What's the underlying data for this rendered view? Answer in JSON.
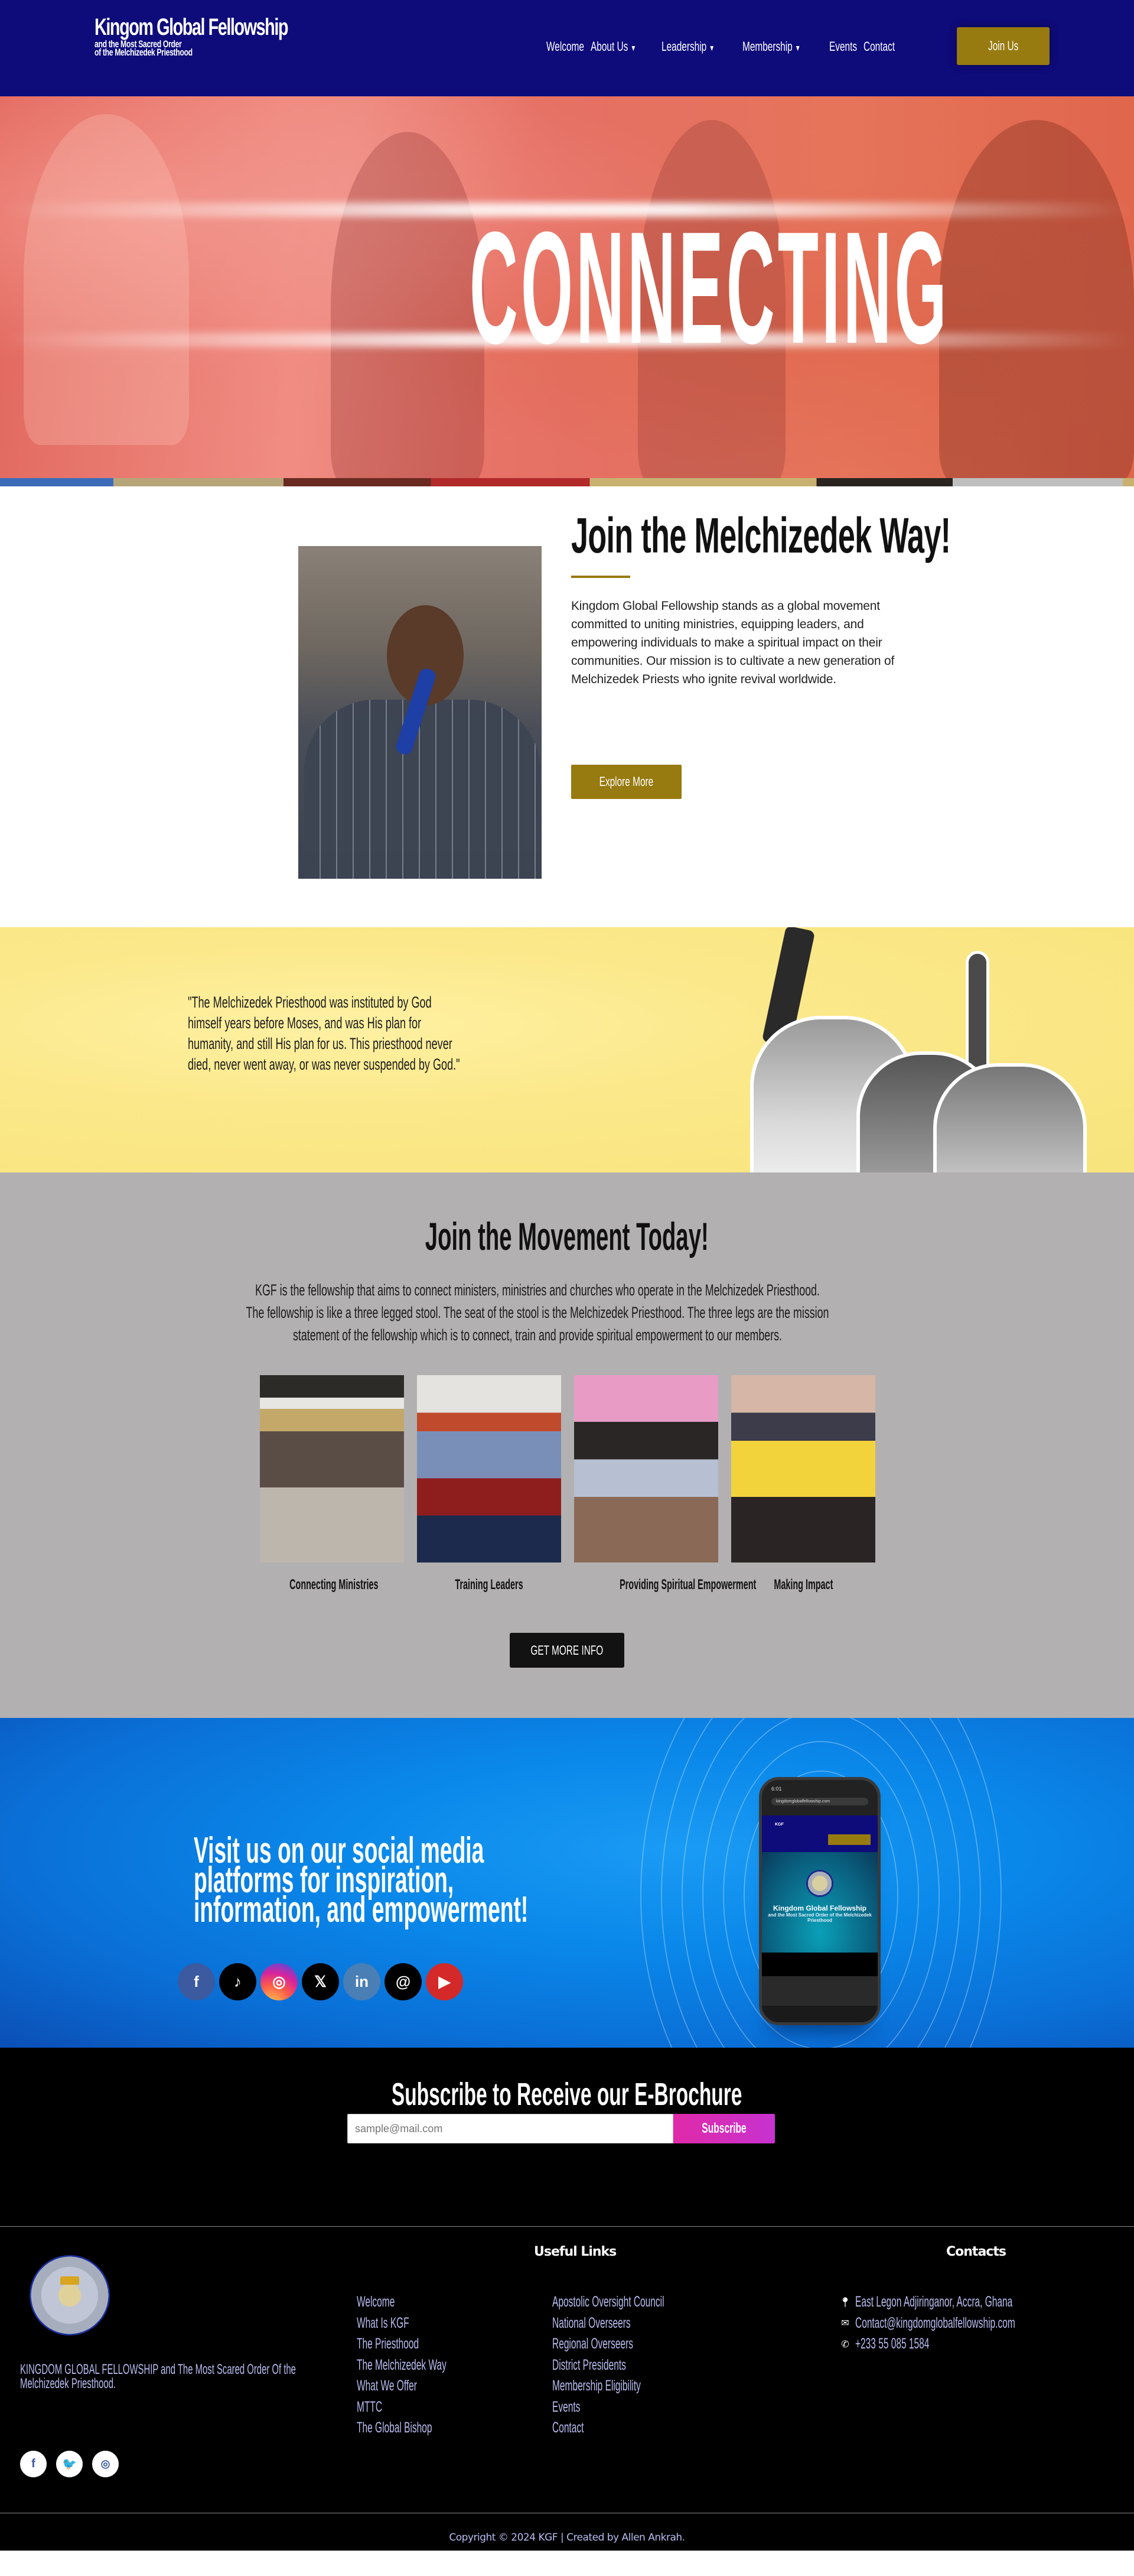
{
  "header": {
    "logo": {
      "title": "Kingom Global Fellowship",
      "subtitle_line1": "and the Most Sacred Order",
      "subtitle_line2": "of the Melchizedek Priesthood"
    },
    "nav": [
      {
        "label": "Welcome",
        "has_dropdown": false
      },
      {
        "label": "About Us",
        "has_dropdown": true
      },
      {
        "label": "Leadership",
        "has_dropdown": true
      },
      {
        "label": "Membership",
        "has_dropdown": true
      },
      {
        "label": "Events",
        "has_dropdown": false
      },
      {
        "label": "Contact",
        "has_dropdown": false
      }
    ],
    "join_label": "Join Us",
    "caret": "▼"
  },
  "hero": {
    "title": "CONNECTING"
  },
  "melchizedek": {
    "title": "Join the Melchizedek Way!",
    "body": "Kingdom Global Fellowship stands as a global movement committed to uniting ministries, equipping leaders, and empowering individuals to make a spiritual impact on their communities. Our mission is to cultivate a new generation of Melchizedek Priests who ignite revival worldwide.",
    "button_label": "Explore More"
  },
  "quote": {
    "text": "\"The Melchizedek Priesthood was instituted by God himself years before Moses, and was His plan for humanity, and still His plan for us. This priesthood never died, never went away, or was never suspended by God.\""
  },
  "movement": {
    "title": "Join the Movement Today!",
    "body": "KGF is the fellowship that aims to connect ministers, ministries and churches who operate in the Melchizedek Priesthood.  The fellowship is like a three legged stool.  The seat of the stool is the Melchizedek Priesthood.  The three legs are the mission statement of the fellowship which is to connect, train and provide spiritual empowerment to our members.",
    "cards": [
      {
        "caption": "Connecting Ministries"
      },
      {
        "caption": "Training Leaders"
      },
      {
        "caption": "Providing Spiritual Empowerment"
      },
      {
        "caption": "Making Impact"
      }
    ],
    "button_label": "GET MORE INFO"
  },
  "social": {
    "title": "Visit us on our social media platforms for inspiration, information, and empowerment!",
    "icons": [
      {
        "name": "facebook",
        "glyph": "f"
      },
      {
        "name": "tiktok",
        "glyph": "♪"
      },
      {
        "name": "instagram",
        "glyph": "◎"
      },
      {
        "name": "x",
        "glyph": "𝕏"
      },
      {
        "name": "linkedin",
        "glyph": "in"
      },
      {
        "name": "threads",
        "glyph": "@"
      },
      {
        "name": "youtube",
        "glyph": "▶"
      }
    ],
    "phone": {
      "time": "6:01",
      "url": "kingdomglobalfellowship.com",
      "screen_title": "Kingdom Global Fellowship",
      "screen_subtitle": "and the Most Sacred Order of the Melchizedek Priesthood"
    }
  },
  "subscribe": {
    "title": "Subscribe to Receive our E-Brochure",
    "email_placeholder": "sample@mail.com",
    "button_label": "Subscribe"
  },
  "footer": {
    "about": "KINGDOM GLOBAL FELLOWSHIP and The Most Scared Order Of the Melchizedek Priesthood.",
    "social": [
      {
        "name": "facebook",
        "glyph": "f"
      },
      {
        "name": "twitter",
        "glyph": "🐦"
      },
      {
        "name": "instagram",
        "glyph": "◎"
      }
    ],
    "useful_links_heading": "Useful Links",
    "links_col1": [
      "Welcome",
      "What Is KGF",
      "The Priesthood",
      "The Melchizedek Way",
      "What We Offer",
      "MTTC",
      "The Global Bishop"
    ],
    "links_col2": [
      "Apostolic Oversight Council",
      "National Overseers",
      "Regional Overseers",
      "District Presidents",
      "Membership Eligibility",
      "Events",
      "Contact"
    ],
    "contacts_heading": "Contacts",
    "contacts": {
      "address": "East Legon Adjiringanor, Accra, Ghana",
      "email": "Contact@kingdomglobalfellowship.com",
      "phone": "+233 55 085 1584"
    },
    "copyright": "Copyright © 2024 KGF | Created by Allen Ankrah."
  },
  "colors": {
    "header_bg": "#0e0b7a",
    "gold": "#977a10",
    "quote_bg": "#f8e47c",
    "movement_bg": "#b2b0b1",
    "social_blue": "#0a88ea",
    "subscribe_pink": "#e02aa8",
    "footer_link": "#b8bdf0"
  }
}
